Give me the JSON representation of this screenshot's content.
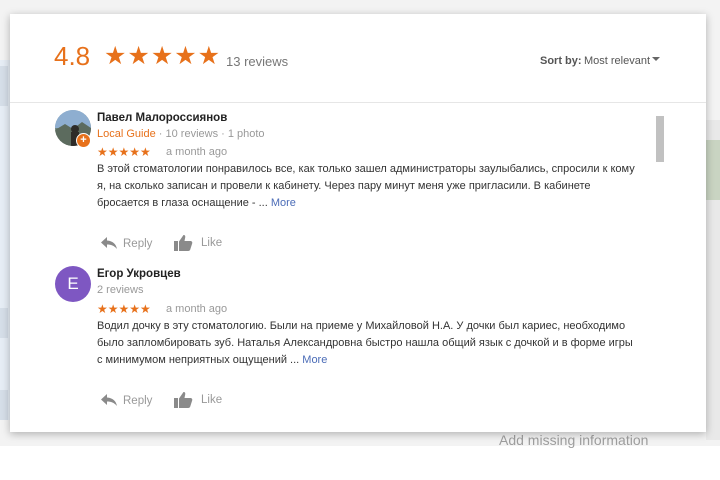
{
  "background": {
    "bottom_text": "Add missing information"
  },
  "header": {
    "rating": "4.8",
    "stars": "★★★★★",
    "review_count": "13 reviews",
    "sort_label": "Sort by:",
    "sort_value": "Most relevant"
  },
  "reviews": [
    {
      "avatar_type": "photo",
      "author": "Павел Малороссиянов",
      "guide_label": "Local Guide",
      "meta": " · 10 reviews · 1 photo",
      "stars": "★★★★★",
      "date": "a month ago",
      "text": "В этой стоматологии понравилось все, как только зашел администраторы заулыбались, спросили к кому я, на сколько записан и провели к кабинету. Через пару минут меня уже пригласили. В кабинете бросается в глаза оснащение - ...",
      "more": "More",
      "reply": "Reply",
      "like": "Like"
    },
    {
      "avatar_type": "letter",
      "avatar_letter": "E",
      "author": "Егор Укровцев",
      "meta": "2 reviews",
      "stars": "★★★★★",
      "date": "a month ago",
      "text": "Водил дочку в эту стоматологию. Были на приеме у Михайловой Н.А. У дочки был кариес, необходимо было запломбировать зуб. Наталья Александровна быстро нашла общий язык с дочкой и в форме игры с минимумом неприятных ощущений ...",
      "more": "More",
      "reply": "Reply",
      "like": "Like"
    }
  ],
  "colors": {
    "accent_star": "#e7711b",
    "link": "#4b6cb7",
    "avatar_letter_bg": "#7e57c2"
  },
  "icons": {
    "reply": "reply-arrow-icon",
    "like": "thumbs-up-icon",
    "sort": "caret-down-icon"
  }
}
